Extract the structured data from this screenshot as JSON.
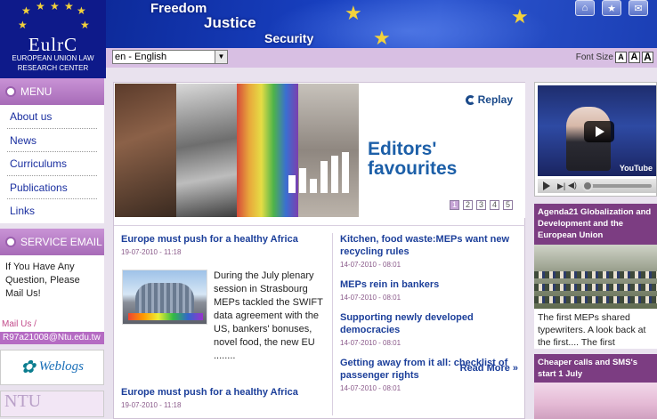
{
  "header": {
    "logo_abbr": "EulrC",
    "logo_name": "EUROPEAN UNION LAW RESEARCH CENTER",
    "banner_words": [
      "Freedom",
      "Justice",
      "Security"
    ],
    "top_icons": [
      "home-icon",
      "star-icon",
      "mail-icon"
    ]
  },
  "toolbar": {
    "language": "en - English",
    "font_size_label": "Font Size",
    "font_size_options": [
      "A",
      "A",
      "A"
    ]
  },
  "sidebar": {
    "menu_title": "MENU",
    "menu_items": [
      "About us",
      "News",
      "Curriculums",
      "Publications",
      "Links"
    ],
    "service_title": "SERVICE EMAIL",
    "service_text": "If You Have Any Question, Please Mail Us!",
    "mail_label": "Mail Us /",
    "mail_address": "R97a21008@Ntu.edu.tw",
    "weblogs_label": "Weblogs",
    "ntu_label": "NTU"
  },
  "slider": {
    "replay_label": "Replay",
    "headline_line1": "Editors'",
    "headline_line2": "favourites",
    "pages": [
      "1",
      "2",
      "3",
      "4",
      "5"
    ],
    "active_page": 1
  },
  "news_left": {
    "title": "Europe must push for a healthy Africa",
    "date": "19-07-2010 - 11:18",
    "text": "During the July plenary session in Strasbourg MEPs tackled the SWIFT data agreement with the US, bankers' bonuses, novel food, the new EU ........",
    "read_more": "Read More",
    "repeat_title": "Europe must push for a healthy Africa",
    "repeat_date": "19-07-2010 - 11:18"
  },
  "news_right": [
    {
      "title": "Kitchen, food waste:MEPs want new recycling rules",
      "date": "14-07-2010 - 08:01"
    },
    {
      "title": "MEPs rein in bankers",
      "date": "14-07-2010 - 08:01"
    },
    {
      "title": "Supporting newly developed democracies",
      "date": "14-07-2010 - 08:01"
    },
    {
      "title": "Getting away from it all: checklist of passenger rights",
      "date": "14-07-2010 - 08:01"
    }
  ],
  "right": {
    "video_brand": "YouTube",
    "agenda_title": "Agenda21 Globalization and Development and the European Union",
    "agenda_text": "The first MEPs shared typewriters. A look back at the first.... The first",
    "cheaper_title": "Cheaper calls and SMS's start 1 July"
  }
}
